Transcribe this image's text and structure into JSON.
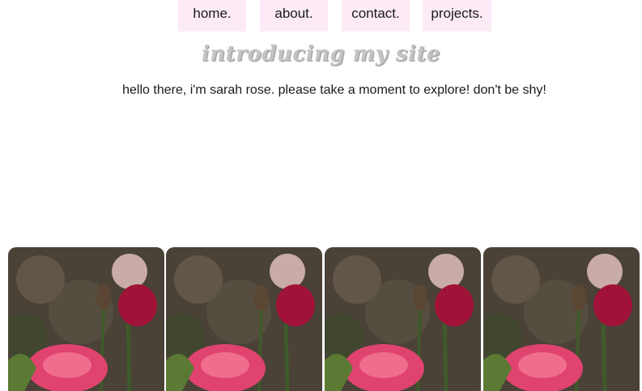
{
  "nav": {
    "items": [
      {
        "label": "home."
      },
      {
        "label": "about."
      },
      {
        "label": "contact."
      },
      {
        "label": "projects."
      }
    ]
  },
  "header": {
    "title": "introducing my site"
  },
  "main": {
    "intro_text": "hello there, i'm sarah rose. please take a moment to explore! don't be shy!"
  },
  "gallery": {
    "photos": [
      {
        "subject": "roses"
      },
      {
        "subject": "roses"
      },
      {
        "subject": "roses"
      },
      {
        "subject": "roses"
      }
    ]
  },
  "colors": {
    "nav_background": "#fcebf6",
    "title": "#c4c4c4",
    "rose_pink": "#e0436e",
    "rose_crimson": "#a11238"
  }
}
